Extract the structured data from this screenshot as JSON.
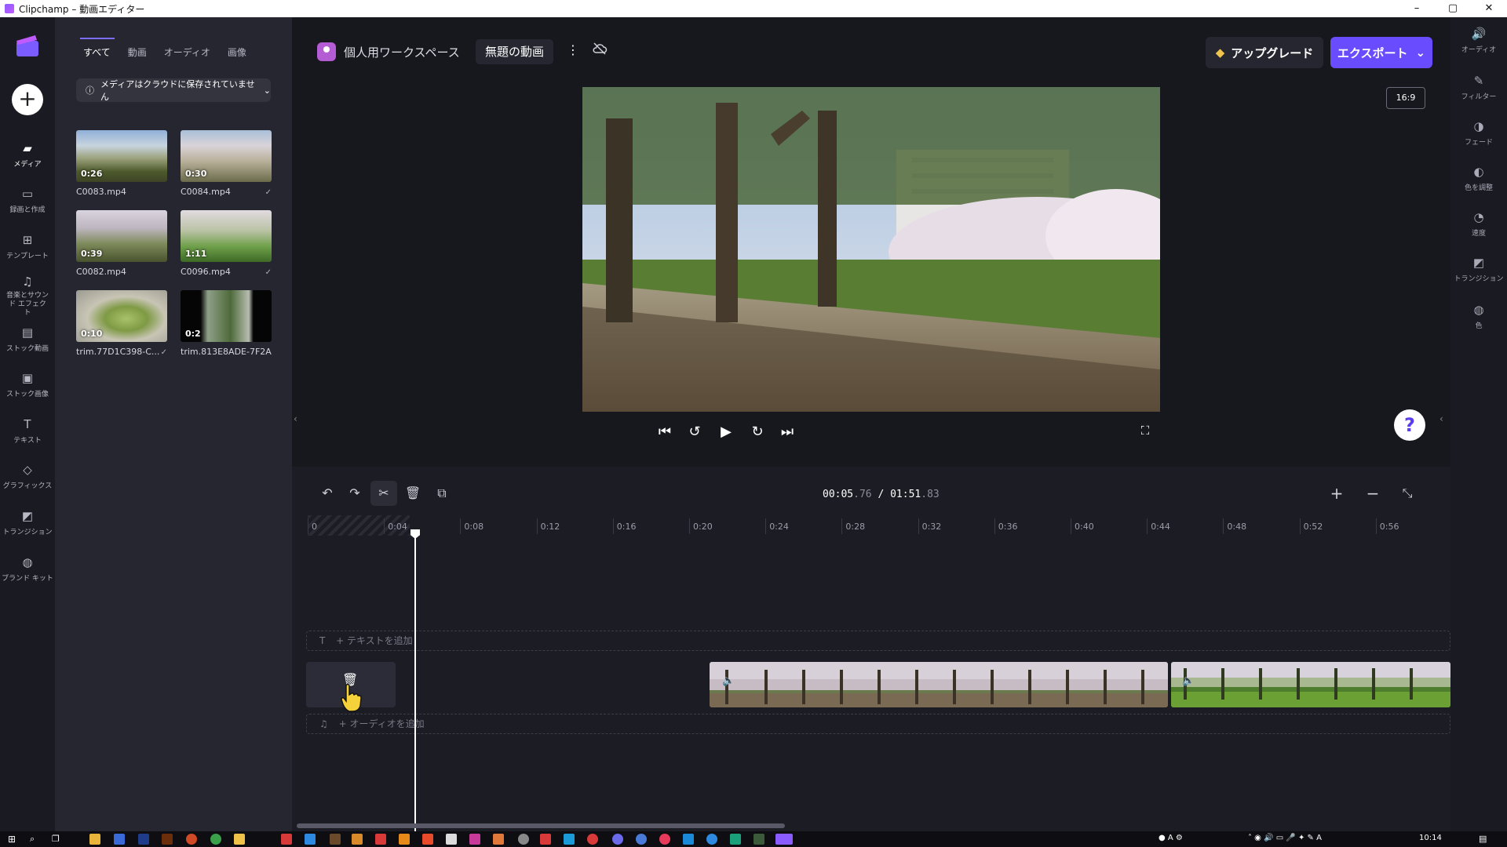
{
  "window": {
    "title": "Clipchamp – 動画エディター",
    "controls": [
      "–",
      "▢",
      "✕"
    ]
  },
  "left_nav": {
    "items": [
      {
        "label": "メディア",
        "icon": "folder-icon"
      },
      {
        "label": "録画と作成",
        "icon": "camera-icon"
      },
      {
        "label": "テンプレート",
        "icon": "template-icon"
      },
      {
        "label": "音楽とサウンド エフェクト",
        "icon": "music-icon"
      },
      {
        "label": "ストック動画",
        "icon": "film-icon"
      },
      {
        "label": "ストック画像",
        "icon": "image-icon"
      },
      {
        "label": "テキスト",
        "icon": "text-icon"
      },
      {
        "label": "グラフィックス",
        "icon": "shapes-icon"
      },
      {
        "label": "トランジション",
        "icon": "transition-icon"
      },
      {
        "label": "ブランド キット",
        "icon": "brand-icon"
      }
    ]
  },
  "media_panel": {
    "tabs": [
      "すべて",
      "動画",
      "オーディオ",
      "画像"
    ],
    "notice": "メディアはクラウドに保存されていません",
    "items": [
      {
        "name": "C0083.mp4",
        "duration": "0:26",
        "check": ""
      },
      {
        "name": "C0084.mp4",
        "duration": "0:30",
        "check": "✓"
      },
      {
        "name": "C0082.mp4",
        "duration": "0:39",
        "check": ""
      },
      {
        "name": "C0096.mp4",
        "duration": "1:11",
        "check": "✓"
      },
      {
        "name": "trim.77D1C398-C...",
        "duration": "0:10",
        "check": "✓"
      },
      {
        "name": "trim.813E8ADE-7F2A...",
        "duration": "0:2",
        "check": ""
      }
    ]
  },
  "header": {
    "workspace": "個人用ワークスペース",
    "separator": "›",
    "project_title": "無題の動画",
    "upgrade_label": "アップグレード",
    "export_label": "エクスポート",
    "aspect_ratio": "16:9"
  },
  "timeline": {
    "time_current": "00:05",
    "time_current_frac": ".76",
    "time_sep": " / ",
    "time_total": "01:51",
    "time_total_frac": ".83",
    "ruler": [
      "0",
      "0:04",
      "0:08",
      "0:12",
      "0:16",
      "0:20",
      "0:24",
      "0:28",
      "0:32",
      "0:36",
      "0:40",
      "0:44",
      "0:48",
      "0:52",
      "0:56"
    ],
    "add_text": "+ テキストを追加",
    "add_audio": "+ オーディオを追加"
  },
  "right_rail": {
    "items": [
      {
        "label": "オーディオ",
        "icon": "speaker-icon"
      },
      {
        "label": "フィルター",
        "icon": "wand-icon"
      },
      {
        "label": "フェード",
        "icon": "fade-icon"
      },
      {
        "label": "色を調整",
        "icon": "color-adjust-icon"
      },
      {
        "label": "速度",
        "icon": "speed-icon"
      },
      {
        "label": "トランジション",
        "icon": "transition-icon"
      },
      {
        "label": "色",
        "icon": "palette-icon"
      }
    ]
  },
  "taskbar": {
    "time": "10:14"
  },
  "colors": {
    "accent": "#6a4cff",
    "bg": "#17171e",
    "panel": "#262630"
  }
}
